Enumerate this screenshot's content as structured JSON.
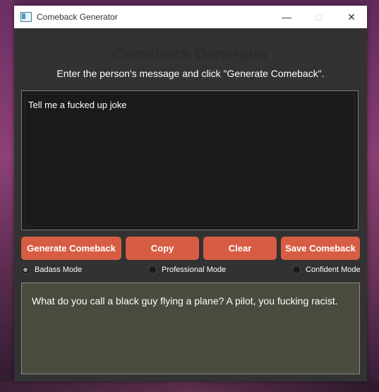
{
  "window": {
    "title": "Comeback Generator"
  },
  "header": {
    "title": "Comeback Generator",
    "instructions": "Enter the person's message and click \"Generate Comeback\"."
  },
  "input": {
    "value": "Tell me a fucked up joke"
  },
  "buttons": {
    "generate": "Generate Comeback",
    "copy": "Copy",
    "clear": "Clear",
    "save": "Save Comeback"
  },
  "modes": [
    {
      "label": "Badass Mode",
      "selected": true
    },
    {
      "label": "Professional Mode",
      "selected": false
    },
    {
      "label": "Confident Mode",
      "selected": false
    }
  ],
  "output": {
    "text": "What do you call a black guy flying a plane? A pilot, you fucking racist."
  },
  "colors": {
    "button": "#d65d43",
    "window_bg": "#323232",
    "input_bg": "#1b1b1b",
    "output_bg": "#4a4a3e"
  }
}
